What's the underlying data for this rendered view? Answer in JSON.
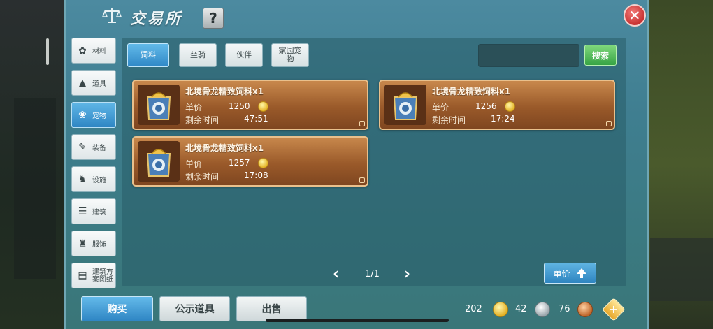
{
  "window": {
    "title": "交易所",
    "help_label": "?",
    "close_label": "✕"
  },
  "sidebar": {
    "items": [
      {
        "label": "材料",
        "icon": "materials-icon",
        "active": false
      },
      {
        "label": "道具",
        "icon": "items-icon",
        "active": false
      },
      {
        "label": "宠物",
        "icon": "paw-icon",
        "active": true
      },
      {
        "label": "装备",
        "icon": "equipment-icon",
        "active": false
      },
      {
        "label": "设施",
        "icon": "facility-icon",
        "active": false
      },
      {
        "label": "建筑",
        "icon": "building-icon",
        "active": false
      },
      {
        "label": "服饰",
        "icon": "clothing-icon",
        "active": false
      },
      {
        "label": "建筑方案图纸",
        "line1": "建筑方",
        "line2": "案图纸",
        "icon": "blueprint-icon",
        "active": false
      }
    ]
  },
  "tabs": [
    {
      "label": "饲料",
      "active": true
    },
    {
      "label": "坐骑",
      "active": false
    },
    {
      "label": "伙伴",
      "active": false
    },
    {
      "label_line1": "家园宠",
      "label_line2": "物",
      "active": false
    }
  ],
  "search": {
    "value": "",
    "button_label": "搜索"
  },
  "listings": [
    {
      "name": "北境骨龙精致饲料x1",
      "price_label": "单价",
      "price": "1250",
      "time_label": "剩余时间",
      "time": "47:51"
    },
    {
      "name": "北境骨龙精致饲料x1",
      "price_label": "单价",
      "price": "1256",
      "time_label": "剩余时间",
      "time": "17:24"
    },
    {
      "name": "北境骨龙精致饲料x1",
      "price_label": "单价",
      "price": "1257",
      "time_label": "剩余时间",
      "time": "17:08"
    }
  ],
  "pagination": {
    "text": "1/1",
    "prev": "‹",
    "next": "›"
  },
  "sort": {
    "label": "单价"
  },
  "bottom": {
    "buy_label": "购买",
    "public_label": "公示道具",
    "sell_label": "出售"
  },
  "currency": {
    "gold": "202",
    "silver": "42",
    "copper": "76",
    "add_label": "+"
  },
  "colors": {
    "panel_bg": "#4c8aa0",
    "active_blue": "#3088c6",
    "card_brown": "#9a5a2a",
    "search_green": "#36a344",
    "close_red": "#c83232"
  }
}
